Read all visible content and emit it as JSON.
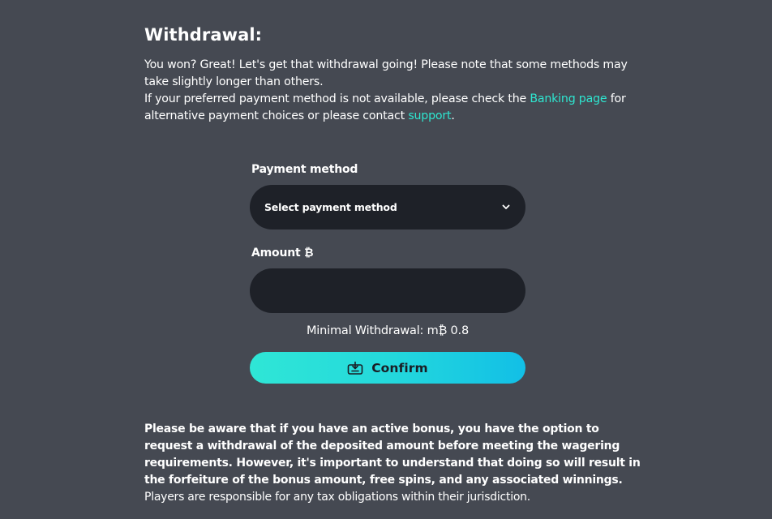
{
  "withdrawal": {
    "title": "Withdrawal:",
    "intro_line1": "You won? Great! Let's get that withdrawal going! Please note that some methods may take slightly longer than others.",
    "intro_line2_before": "If your preferred payment method is not available, please check the ",
    "banking_link": "Banking page",
    "intro_line2_middle": " for alternative payment choices or please contact ",
    "support_link": "support",
    "intro_line2_after": "."
  },
  "form": {
    "payment_method_label": "Payment method",
    "payment_method_value": "Select payment method",
    "amount_label": "Amount ₿",
    "amount_value": "",
    "min_withdrawal": "Minimal Withdrawal: m₿ 0.8",
    "confirm_label": "Confirm"
  },
  "notice": {
    "bonus_text": "Please be aware that if you have an active bonus, you have the option to request a withdrawal of the deposited amount before meeting the wagering requirements. However, it's important to understand that doing so will result in the forfeiture of the bonus amount, free spins, and any associated winnings.",
    "tax_text": "Players are responsible for any tax obligations within their jurisdiction."
  },
  "icons": {
    "dropdown": "chevron-down-icon",
    "confirm": "wallet-icon"
  },
  "colors": {
    "background": "#454952",
    "field": "#1e2128",
    "link": "#2ee6d0",
    "button_start": "#2fe6d6",
    "button_end": "#12bfe6"
  }
}
